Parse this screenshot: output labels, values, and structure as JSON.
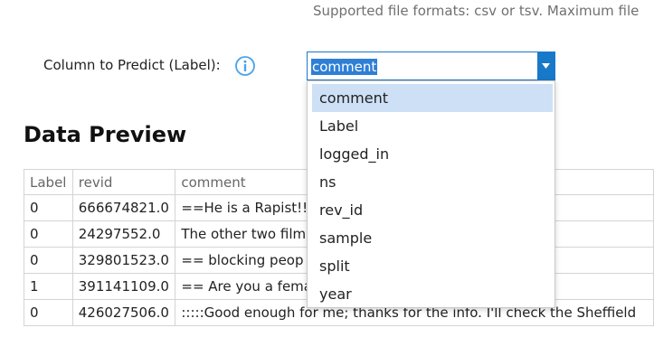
{
  "header": {
    "supported_formats": "Supported file formats: csv or tsv. Maximum file"
  },
  "form": {
    "column_label": "Column to Predict (Label):",
    "selected_value": "comment",
    "info_icon": "info-circle-icon",
    "dropdown_arrow_icon": "chevron-down-icon",
    "options": [
      "comment",
      "Label",
      "logged_in",
      "ns",
      "rev_id",
      "sample",
      "split",
      "year"
    ]
  },
  "preview": {
    "title": "Data Preview",
    "columns": [
      "Label",
      "revid",
      "comment"
    ],
    "rows": [
      [
        "0",
        "666674821.0",
        "==He is a Rapist!!!                                    de this import"
      ],
      [
        "0",
        "24297552.0",
        "The other two film                                     ctly related to"
      ],
      [
        "0",
        "329801523.0",
        "== blocking peop                                      om my page a"
      ],
      [
        "1",
        "391141109.0",
        "== Are you a fema                                     tmootmootme"
      ],
      [
        "0",
        "426027506.0",
        ":::::Good enough for me; thanks for the info. I'll check the Sheffield"
      ]
    ]
  },
  "colors": {
    "accent": "#1979c9",
    "selection": "#2e7fd6",
    "highlight": "#cde0f5"
  }
}
